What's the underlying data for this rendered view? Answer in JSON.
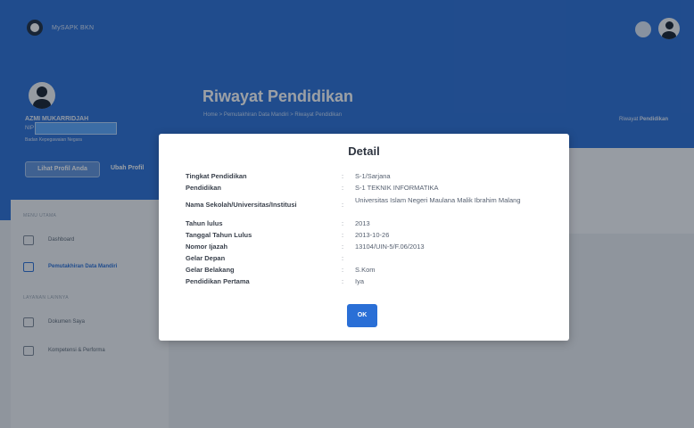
{
  "topbar": {
    "app_name": "MySAPK BKN"
  },
  "profile": {
    "name": "AZMI MUKARRIDJAH",
    "nip_label": "NIP",
    "nip_value": "",
    "role": "Badan Kepegawaian Negara",
    "view_profile_label": "Lihat Profil Anda",
    "edit_profile_label": "Ubah Profil"
  },
  "header": {
    "title": "Riwayat Pendidikan",
    "breadcrumb": "Home  >  Pemutakhiran Data Mandiri  >  Riwayat Pendidikan",
    "breadcrumb_right_prefix": "Riwayat",
    "breadcrumb_right_bold": "Pendidikan"
  },
  "sidebar": {
    "section_main": "MENU UTAMA",
    "section_other": "LAYANAN LAINNYA",
    "items": [
      {
        "label": "Dashboard"
      },
      {
        "label": "Pemutakhiran Data Mandiri"
      },
      {
        "label": "Dokumen Saya"
      },
      {
        "label": "Kompetensi & Performa"
      }
    ]
  },
  "modal": {
    "title": "Detail",
    "rows": [
      {
        "label": "Tingkat Pendidikan",
        "value": "S-1/Sarjana"
      },
      {
        "label": "Pendidikan",
        "value": "S-1 TEKNIK INFORMATIKA"
      },
      {
        "label": "Nama Sekolah/Universitas/Institusi",
        "value": "Universitas Islam Negeri Maulana Malik Ibrahim Malang"
      },
      {
        "label": "Tahun lulus",
        "value": "2013"
      },
      {
        "label": "Tanggal Tahun Lulus",
        "value": "2013-10-26"
      },
      {
        "label": "Nomor Ijazah",
        "value": "13104/UIN-5/F.06/2013"
      },
      {
        "label": "Gelar Depan",
        "value": ""
      },
      {
        "label": "Gelar Belakang",
        "value": "S.Kom"
      },
      {
        "label": "Pendidikan Pertama",
        "value": "Iya"
      }
    ],
    "separator": ":",
    "ok_label": "OK"
  },
  "colors": {
    "primary": "#2a6fd6",
    "overlay": "rgba(20,28,40,0.42)"
  }
}
